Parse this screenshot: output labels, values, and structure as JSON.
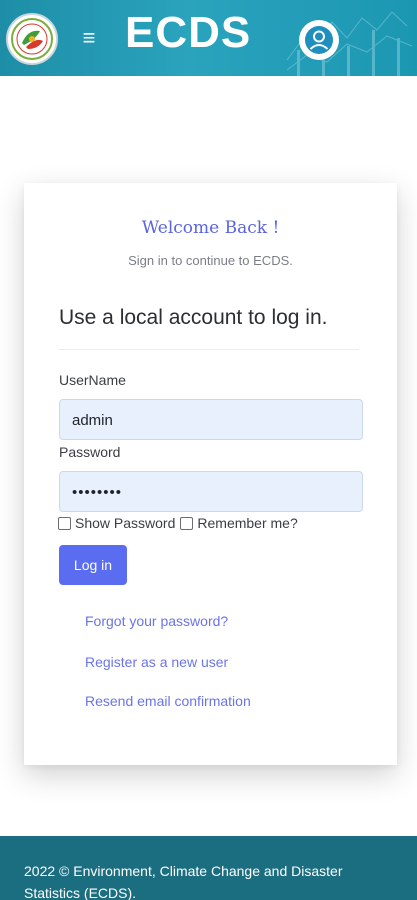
{
  "header": {
    "title": "ECDS",
    "logo_icon": "ecds-logo-icon",
    "menu_icon": "hamburger-menu-icon",
    "user_icon": "user-account-icon",
    "colors": {
      "header_bg": "#1f94ad",
      "accent": "#5a6df0"
    }
  },
  "login": {
    "welcome": "Welcome Back !",
    "subtitle": "Sign in to continue to ECDS.",
    "heading": "Use a local account to log in.",
    "username_label": "UserName",
    "username_value": "admin",
    "password_label": "Password",
    "password_value": "••••••••",
    "show_password_label": "Show Password",
    "remember_me_label": "Remember me?",
    "login_button": "Log in"
  },
  "links": {
    "forgot": "Forgot your password?",
    "register": "Register as a new user",
    "resend": "Resend email confirmation"
  },
  "footer": {
    "text": "2022 © Environment, Climate Change and Disaster Statistics (ECDS)."
  }
}
